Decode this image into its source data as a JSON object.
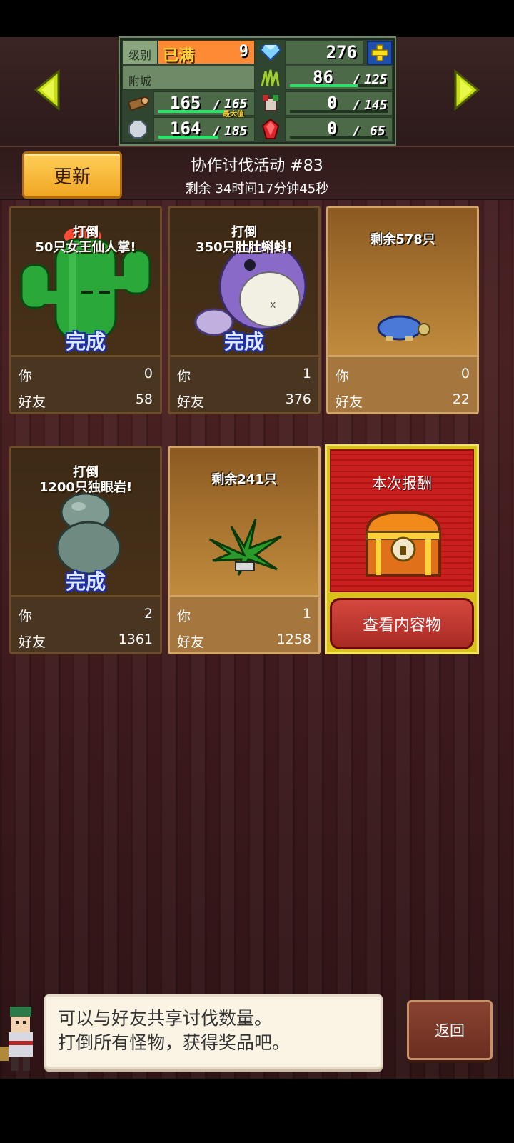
{
  "status": {
    "level_label": "级别",
    "level_max_text": "已满",
    "level_value": "9",
    "gems": "276",
    "city_label": "附城",
    "grass_current": "86",
    "grass_max": "125",
    "wood_current": "165",
    "wood_max": "165",
    "wood_max_tag": "最大值",
    "monster_current": "0",
    "monster_max": "145",
    "stone_current": "164",
    "stone_max": "185",
    "ruby_current": "0",
    "ruby_max": "65",
    "slash": "/"
  },
  "event": {
    "update_button": "更新",
    "title": "协作讨伐活动 #83",
    "remaining": "剩余 34时间17分钟45秒"
  },
  "labels": {
    "you": "你",
    "friends": "好友",
    "done": "完成"
  },
  "cards": [
    {
      "goal_line1": "打倒",
      "goal_line2": "50只女王仙人掌!",
      "done": true,
      "you": "0",
      "friends": "58"
    },
    {
      "goal_line1": "打倒",
      "goal_line2": "350只肚肚蝌蚪!",
      "done": true,
      "you": "1",
      "friends": "376"
    },
    {
      "goal_line1": "剩余578只",
      "goal_line2": "",
      "done": false,
      "you": "0",
      "friends": "22"
    },
    {
      "goal_line1": "打倒",
      "goal_line2": "1200只独眼岩!",
      "done": true,
      "you": "2",
      "friends": "1361"
    },
    {
      "goal_line1": "剩余241只",
      "goal_line2": "",
      "done": false,
      "you": "1",
      "friends": "1258"
    }
  ],
  "reward": {
    "title": "本次报酬",
    "view_button": "查看内容物"
  },
  "dialog": {
    "line1": "可以与好友共享讨伐数量。",
    "line2": "打倒所有怪物，获得奖品吧。"
  },
  "back_button": "返回",
  "icons": {
    "left": "arrow-left-icon",
    "right": "arrow-right-icon",
    "gem": "diamond-icon",
    "plus": "plus-icon",
    "grass": "grass-icon",
    "wood": "wood-log-icon",
    "monster": "monster-icon",
    "stone": "stone-icon",
    "ruby": "ruby-icon",
    "chest": "treasure-chest-icon"
  }
}
